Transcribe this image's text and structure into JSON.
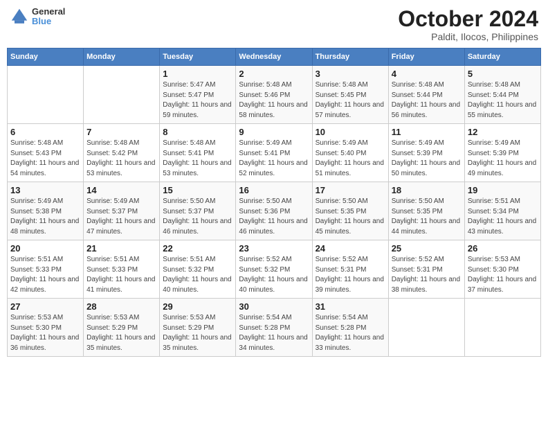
{
  "header": {
    "logo_line1": "General",
    "logo_line2": "Blue",
    "title": "October 2024",
    "subtitle": "Paldit, Ilocos, Philippines"
  },
  "days_of_week": [
    "Sunday",
    "Monday",
    "Tuesday",
    "Wednesday",
    "Thursday",
    "Friday",
    "Saturday"
  ],
  "weeks": [
    [
      {
        "day": "",
        "info": ""
      },
      {
        "day": "",
        "info": ""
      },
      {
        "day": "1",
        "info": "Sunrise: 5:47 AM\nSunset: 5:47 PM\nDaylight: 11 hours and 59 minutes."
      },
      {
        "day": "2",
        "info": "Sunrise: 5:48 AM\nSunset: 5:46 PM\nDaylight: 11 hours and 58 minutes."
      },
      {
        "day": "3",
        "info": "Sunrise: 5:48 AM\nSunset: 5:45 PM\nDaylight: 11 hours and 57 minutes."
      },
      {
        "day": "4",
        "info": "Sunrise: 5:48 AM\nSunset: 5:44 PM\nDaylight: 11 hours and 56 minutes."
      },
      {
        "day": "5",
        "info": "Sunrise: 5:48 AM\nSunset: 5:44 PM\nDaylight: 11 hours and 55 minutes."
      }
    ],
    [
      {
        "day": "6",
        "info": "Sunrise: 5:48 AM\nSunset: 5:43 PM\nDaylight: 11 hours and 54 minutes."
      },
      {
        "day": "7",
        "info": "Sunrise: 5:48 AM\nSunset: 5:42 PM\nDaylight: 11 hours and 53 minutes."
      },
      {
        "day": "8",
        "info": "Sunrise: 5:48 AM\nSunset: 5:41 PM\nDaylight: 11 hours and 53 minutes."
      },
      {
        "day": "9",
        "info": "Sunrise: 5:49 AM\nSunset: 5:41 PM\nDaylight: 11 hours and 52 minutes."
      },
      {
        "day": "10",
        "info": "Sunrise: 5:49 AM\nSunset: 5:40 PM\nDaylight: 11 hours and 51 minutes."
      },
      {
        "day": "11",
        "info": "Sunrise: 5:49 AM\nSunset: 5:39 PM\nDaylight: 11 hours and 50 minutes."
      },
      {
        "day": "12",
        "info": "Sunrise: 5:49 AM\nSunset: 5:39 PM\nDaylight: 11 hours and 49 minutes."
      }
    ],
    [
      {
        "day": "13",
        "info": "Sunrise: 5:49 AM\nSunset: 5:38 PM\nDaylight: 11 hours and 48 minutes."
      },
      {
        "day": "14",
        "info": "Sunrise: 5:49 AM\nSunset: 5:37 PM\nDaylight: 11 hours and 47 minutes."
      },
      {
        "day": "15",
        "info": "Sunrise: 5:50 AM\nSunset: 5:37 PM\nDaylight: 11 hours and 46 minutes."
      },
      {
        "day": "16",
        "info": "Sunrise: 5:50 AM\nSunset: 5:36 PM\nDaylight: 11 hours and 46 minutes."
      },
      {
        "day": "17",
        "info": "Sunrise: 5:50 AM\nSunset: 5:35 PM\nDaylight: 11 hours and 45 minutes."
      },
      {
        "day": "18",
        "info": "Sunrise: 5:50 AM\nSunset: 5:35 PM\nDaylight: 11 hours and 44 minutes."
      },
      {
        "day": "19",
        "info": "Sunrise: 5:51 AM\nSunset: 5:34 PM\nDaylight: 11 hours and 43 minutes."
      }
    ],
    [
      {
        "day": "20",
        "info": "Sunrise: 5:51 AM\nSunset: 5:33 PM\nDaylight: 11 hours and 42 minutes."
      },
      {
        "day": "21",
        "info": "Sunrise: 5:51 AM\nSunset: 5:33 PM\nDaylight: 11 hours and 41 minutes."
      },
      {
        "day": "22",
        "info": "Sunrise: 5:51 AM\nSunset: 5:32 PM\nDaylight: 11 hours and 40 minutes."
      },
      {
        "day": "23",
        "info": "Sunrise: 5:52 AM\nSunset: 5:32 PM\nDaylight: 11 hours and 40 minutes."
      },
      {
        "day": "24",
        "info": "Sunrise: 5:52 AM\nSunset: 5:31 PM\nDaylight: 11 hours and 39 minutes."
      },
      {
        "day": "25",
        "info": "Sunrise: 5:52 AM\nSunset: 5:31 PM\nDaylight: 11 hours and 38 minutes."
      },
      {
        "day": "26",
        "info": "Sunrise: 5:53 AM\nSunset: 5:30 PM\nDaylight: 11 hours and 37 minutes."
      }
    ],
    [
      {
        "day": "27",
        "info": "Sunrise: 5:53 AM\nSunset: 5:30 PM\nDaylight: 11 hours and 36 minutes."
      },
      {
        "day": "28",
        "info": "Sunrise: 5:53 AM\nSunset: 5:29 PM\nDaylight: 11 hours and 35 minutes."
      },
      {
        "day": "29",
        "info": "Sunrise: 5:53 AM\nSunset: 5:29 PM\nDaylight: 11 hours and 35 minutes."
      },
      {
        "day": "30",
        "info": "Sunrise: 5:54 AM\nSunset: 5:28 PM\nDaylight: 11 hours and 34 minutes."
      },
      {
        "day": "31",
        "info": "Sunrise: 5:54 AM\nSunset: 5:28 PM\nDaylight: 11 hours and 33 minutes."
      },
      {
        "day": "",
        "info": ""
      },
      {
        "day": "",
        "info": ""
      }
    ]
  ]
}
